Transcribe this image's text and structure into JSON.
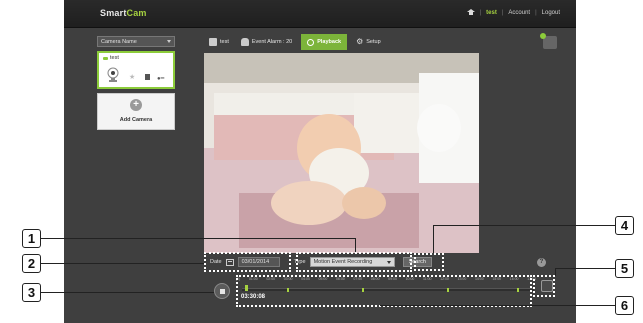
{
  "app": {
    "brand": "SmartCam",
    "brand_main": "Smart",
    "brand_accent": "Cam",
    "top_links": {
      "user": "test",
      "separator": "|",
      "account": "Account",
      "logout": "Logout"
    }
  },
  "sidebar": {
    "camera_select": "Camera Name",
    "camera_card": {
      "name": "test"
    },
    "add_camera_label": "Add Camera"
  },
  "tabs": [
    {
      "label": "test"
    },
    {
      "label": "Event Alarm : 20"
    },
    {
      "label": "Playback",
      "active": true
    },
    {
      "label": "Setup"
    }
  ],
  "controls": {
    "date_label": "Date",
    "date_value": "03/01/2014",
    "type_label": "Type",
    "type_value": "Motion Event Recording",
    "search_label": "Search",
    "help_label": "?"
  },
  "timeline": {
    "ticks": [
      "(0)",
      "01:00",
      "02:00",
      "03:00",
      "04:00",
      "05:00",
      "06:00",
      "07:00",
      "08:00",
      "09:00",
      "10:00",
      "11:00",
      "12:00",
      "13:00",
      "14:00",
      "15:00",
      "16:00",
      "17:00"
    ],
    "current_time": "03:30:08"
  },
  "callouts": [
    "1",
    "2",
    "3",
    "4",
    "5",
    "6"
  ],
  "colors": {
    "accent": "#8ccc3a",
    "frame": "#3f3f3f",
    "topbar": "#222222"
  }
}
